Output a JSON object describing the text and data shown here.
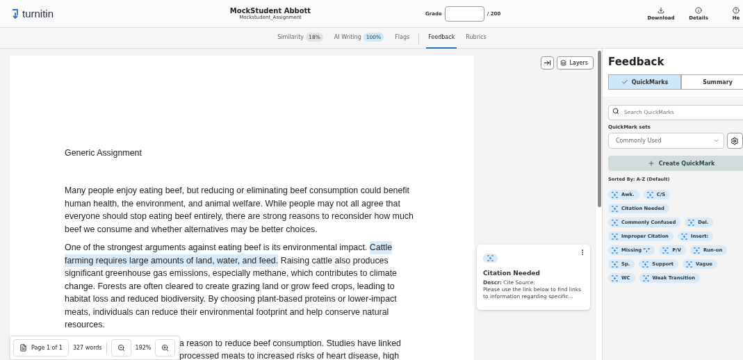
{
  "header": {
    "logo": "turnitin",
    "student": "MockStudent Abbott",
    "assignment": "Mockstudent_Assignment",
    "grade": {
      "label": "Grade",
      "max": "/ 200"
    },
    "actions": [
      {
        "kind": "download",
        "label": "Download"
      },
      {
        "kind": "details",
        "label": "Details"
      },
      {
        "kind": "help",
        "label": "He"
      }
    ]
  },
  "tabs": [
    {
      "label": "Similarity",
      "badge": "18%",
      "selected": false
    },
    {
      "label": "AI Writing",
      "badge": "100%",
      "selected": false
    },
    {
      "label": "Flags",
      "selected": false
    },
    {
      "label": "Feedback",
      "selected": true
    },
    {
      "label": "Rubrics",
      "selected": false
    }
  ],
  "document": {
    "title": "Generic Assignment",
    "paragraphs": [
      {
        "lines": [
          [
            {
              "text": "Many people enjoy eating beef, but reducing or eliminating beef consumption could benefit",
              "highlighted": false
            }
          ],
          [
            {
              "text": "human health, the environment, and animal welfare. While people may not all agree that",
              "highlighted": false
            }
          ],
          [
            {
              "text": "everyone should stop eating beef entirely, there are strong reasons to reconsider how much",
              "highlighted": false
            }
          ],
          [
            {
              "text": "beef we consume and whether alternatives may be better choices.",
              "highlighted": false
            }
          ]
        ]
      },
      {
        "lines": [
          [
            {
              "text": "One of the strongest arguments against eating beef is its environmental impact.",
              "highlighted": false
            },
            {
              "text": "Cattle",
              "highlighted": true
            }
          ],
          [
            {
              "text": "farming requires large amounts of land, water, and feed.",
              "highlighted": true
            },
            {
              "text": "Raising cattle also produces",
              "highlighted": false
            }
          ],
          [
            {
              "text": "significant greenhouse gas emissions, especially methane, which contributes to climate",
              "highlighted": false
            }
          ],
          [
            {
              "text": "change. Forests are often cleared to create grazing land or grow feed crops, leading to",
              "highlighted": false
            }
          ],
          [
            {
              "text": "habitat loss and reduced biodiversity. By choosing plant-based proteins or lower-impact",
              "highlighted": false
            }
          ],
          [
            {
              "text": "meats, individuals can reduce their environmental footprint and help conserve natural",
              "highlighted": false
            }
          ],
          [
            {
              "text": "resources.",
              "highlighted": false
            }
          ]
        ]
      }
    ],
    "partial_lines": [
      "a reason to reduce beef consumption. Studies have linked",
      "processed meats to increased risks of heart disease, high"
    ]
  },
  "doc_toolbar": {
    "page": "Page 1 of 1",
    "words": "327 words",
    "zoom": "192%"
  },
  "margin": {
    "buttons": [
      {
        "kind": "collapse"
      },
      {
        "kind": "layers",
        "label": "Layers"
      }
    ],
    "comment": {
      "title": "Citation Needed",
      "descr_label": "Descr:",
      "descr": "Cite Source:",
      "body": "Please use the link below to find links to information regarding specific..."
    }
  },
  "feedback": {
    "title": "Feedback",
    "segments": [
      {
        "label": "QuickMarks",
        "selected": true
      },
      {
        "label": "Summary",
        "selected": false
      }
    ],
    "search": {
      "placeholder": "Search QuickMarks"
    },
    "sets_label": "QuickMark sets",
    "set_value": "Commonly Used",
    "create": "Create QuickMark",
    "sorted": "Sorted By: A-Z (Default)",
    "quickmarks": [
      "Awk.",
      "C/S",
      "Citation Needed",
      "Commonly Confused",
      "Del.",
      "Improper Citation",
      "Insert:",
      "Missing \",\"",
      "P/V",
      "Run-on",
      "Sp.",
      "Support",
      "Vague",
      "WC",
      "Weak Transition"
    ]
  }
}
